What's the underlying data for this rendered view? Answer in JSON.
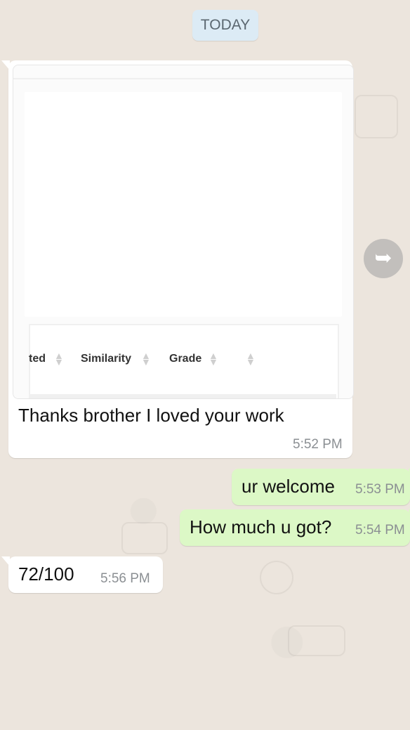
{
  "chat": {
    "date_chip": "TODAY",
    "image_message": {
      "table_headers": [
        {
          "label": "ted"
        },
        {
          "label": "Similarity"
        },
        {
          "label": "Grade"
        },
        {
          "label": ""
        }
      ],
      "caption": "Thanks brother I loved your work",
      "time": "5:52 PM"
    },
    "messages": [
      {
        "direction": "outgoing",
        "text": "ur welcome",
        "time": "5:53 PM"
      },
      {
        "direction": "outgoing",
        "text": "How much u got?",
        "time": "5:54 PM"
      },
      {
        "direction": "incoming",
        "text": "72/100",
        "time": "5:56 PM"
      }
    ]
  },
  "icons": {
    "forward": "forward-icon",
    "sort": "sort-icon"
  },
  "colors": {
    "chat_background": "#ece5dd",
    "incoming_bubble": "#ffffff",
    "outgoing_bubble": "#dcf8c6",
    "date_chip": "#dcebf5",
    "forward_button": "#a0a0a0"
  }
}
